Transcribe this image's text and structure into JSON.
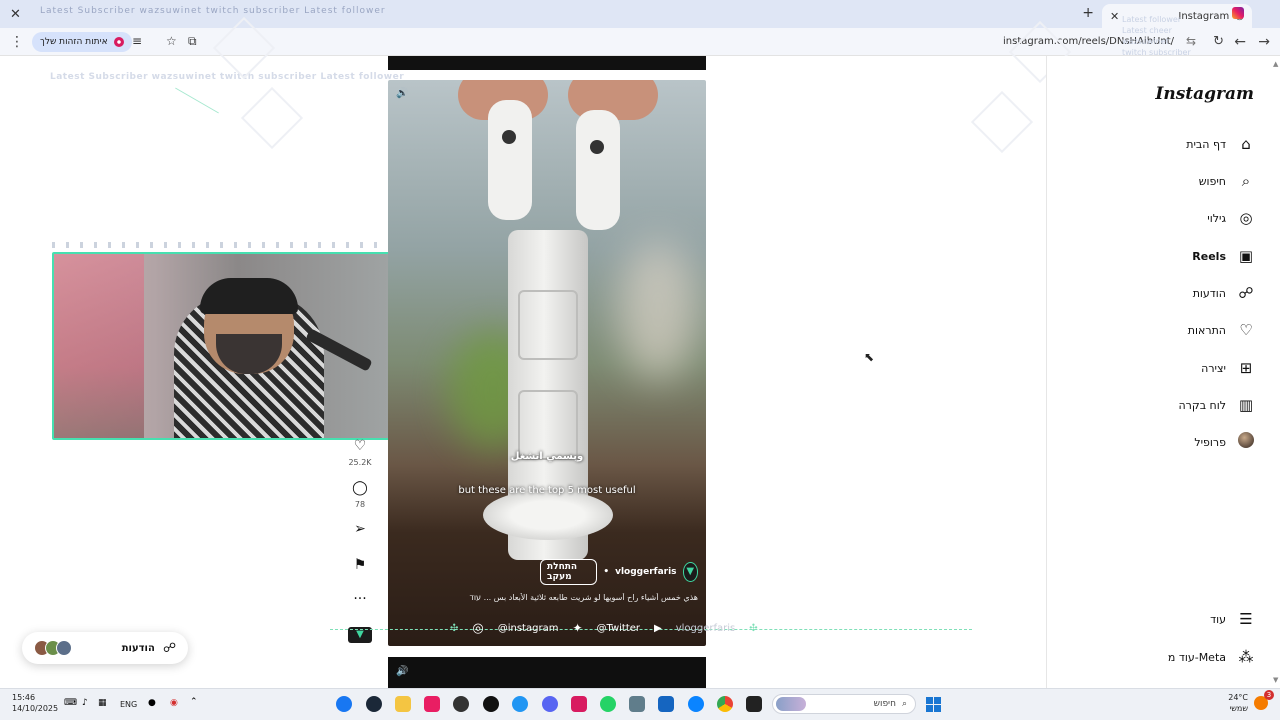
{
  "browser": {
    "tab_title": "Instagram",
    "tab_ticker": "Latest Subscriber  wazsuwinet  twitch subscriber  Latest follower",
    "url": "instagram.com/reels/DNsHAibUnt/",
    "identity_chip": "איתות הזהות שלך",
    "icons": [
      "close-icon",
      "new-tab-icon",
      "back-icon",
      "forward-icon",
      "reload-icon",
      "star-icon",
      "menu-icon"
    ]
  },
  "overlay": {
    "subscriber_ticker": "Latest Subscriber  wazsuwinet  twitch subscriber  Latest follower",
    "right_ticker": [
      "Latest follower",
      "Latest cheer",
      "wazsuwinet",
      "twitch subscriber"
    ]
  },
  "instagram": {
    "logo": "Instagram",
    "nav": [
      {
        "label": "דף הבית",
        "icon": "home-icon",
        "glyph": "⌂"
      },
      {
        "label": "חיפוש",
        "icon": "search-icon",
        "glyph": "⌕"
      },
      {
        "label": "גילוי",
        "icon": "compass-icon",
        "glyph": "◎"
      },
      {
        "label": "Reels",
        "icon": "reels-icon",
        "glyph": "▣",
        "active": true
      },
      {
        "label": "הודעות",
        "icon": "messenger-icon",
        "glyph": "☍"
      },
      {
        "label": "התראות",
        "icon": "heart-icon",
        "glyph": "♡"
      },
      {
        "label": "יצירה",
        "icon": "create-icon",
        "glyph": "⊞"
      },
      {
        "label": "לוח בקרה",
        "icon": "dashboard-icon",
        "glyph": "▥"
      },
      {
        "label": "פרופיל",
        "icon": "profile-avatar",
        "glyph": ""
      }
    ],
    "more_label": "עוד",
    "meta_label": "עוד מ-Meta",
    "messages_label": "הודעות"
  },
  "reel": {
    "caption_ar": "وبسمي اتشغل",
    "caption_en": "but these are the top 5 most useful",
    "author": "vloggerfaris",
    "follow_label": "התחלת מעקב",
    "description": "هذي خمس أشياء راح أسويها لو شريت طابعه ثلاثية الأبعاد بس ... עוד",
    "likes": "25.2K",
    "comments": "78"
  },
  "socials": {
    "instagram": "@instagram",
    "twitter": "@Twitter",
    "other": "vloggerfaris"
  },
  "taskbar": {
    "time": "15:46",
    "date": "14/10/2025",
    "lang": "ENG",
    "search_placeholder": "חיפוש",
    "weather_temp": "24°C",
    "weather_label": "שמשי",
    "notif_count": "3"
  },
  "colors": {
    "accent_green": "#46e0b0",
    "chip_blue": "#d6e2fb",
    "tabbar": "#dfe6f5"
  }
}
